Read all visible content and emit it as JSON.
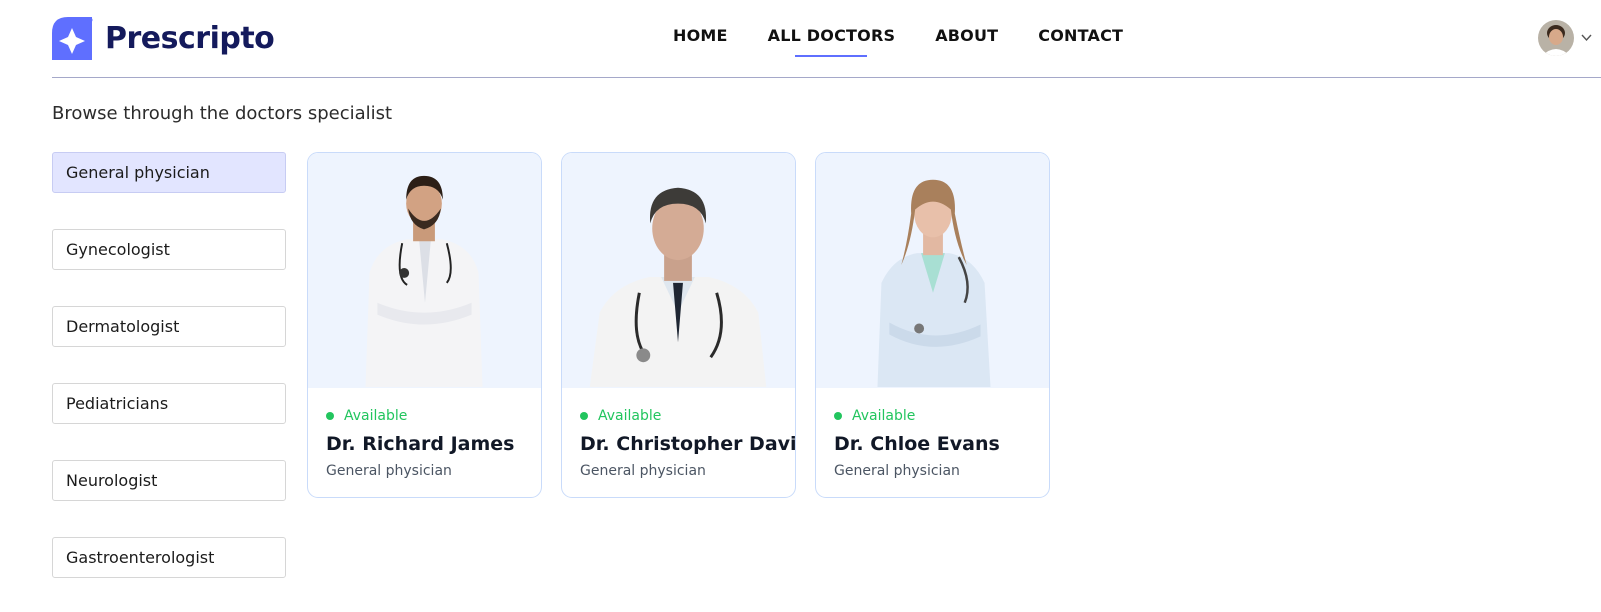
{
  "brand": {
    "name": "Prescripto",
    "logo_icon": "sparkle-star-icon",
    "color": "#5f6fff"
  },
  "nav": {
    "items": [
      {
        "label": "HOME"
      },
      {
        "label": "ALL DOCTORS",
        "active": true
      },
      {
        "label": "ABOUT"
      },
      {
        "label": "CONTACT"
      }
    ]
  },
  "profile": {
    "avatar_icon": "user-avatar",
    "menu_icon": "chevron-down-icon"
  },
  "intro": "Browse through the doctors specialist",
  "specialities": [
    {
      "label": "General physician",
      "selected": true
    },
    {
      "label": "Gynecologist"
    },
    {
      "label": "Dermatologist"
    },
    {
      "label": "Pediatricians"
    },
    {
      "label": "Neurologist"
    },
    {
      "label": "Gastroenterologist"
    }
  ],
  "doctors": [
    {
      "status": "Available",
      "name": "Dr. Richard James",
      "speciality": "General physician"
    },
    {
      "status": "Available",
      "name": "Dr. Christopher Davis",
      "speciality": "General physician"
    },
    {
      "status": "Available",
      "name": "Dr. Chloe Evans",
      "speciality": "General physician"
    }
  ],
  "colors": {
    "accent": "#5f6fff",
    "available": "#22c55e",
    "selected_bg": "#e2e5ff",
    "card_bg": "#eef4fe"
  }
}
